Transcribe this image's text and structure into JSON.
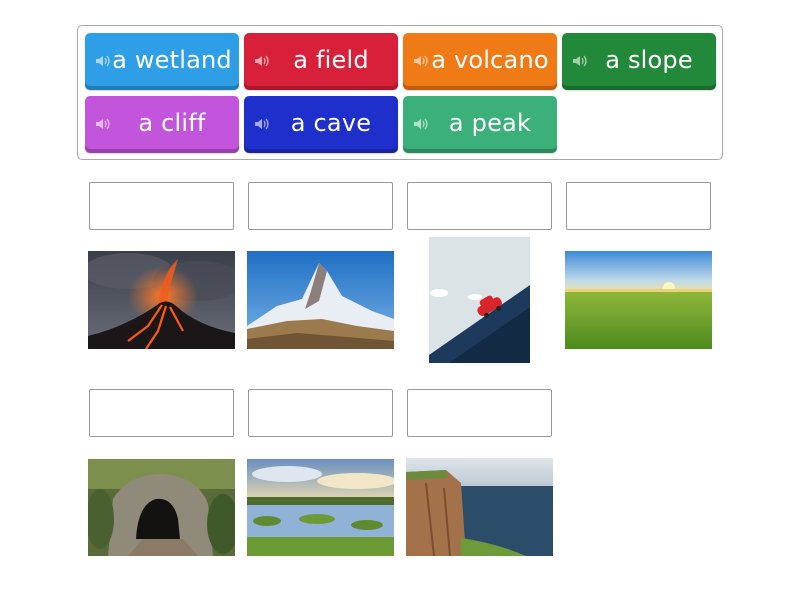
{
  "word_bank": {
    "chips": [
      {
        "label": "a wetland",
        "color": "#2e9fe6"
      },
      {
        "label": "a field",
        "color": "#d8203a"
      },
      {
        "label": "a volcano",
        "color": "#f07a15"
      },
      {
        "label": "a slope",
        "color": "#22893a"
      },
      {
        "label": "a cliff",
        "color": "#c255db"
      },
      {
        "label": "a cave",
        "color": "#1f2fcc"
      },
      {
        "label": "a peak",
        "color": "#3bb07a"
      }
    ],
    "icon": "speaker-icon"
  },
  "answer_slots": {
    "count": 7
  },
  "pictures": [
    {
      "name": "volcano-image"
    },
    {
      "name": "mountain-peak-image"
    },
    {
      "name": "slope-car-image"
    },
    {
      "name": "field-image"
    },
    {
      "name": "cave-image"
    },
    {
      "name": "wetland-image"
    },
    {
      "name": "cliff-image"
    }
  ]
}
